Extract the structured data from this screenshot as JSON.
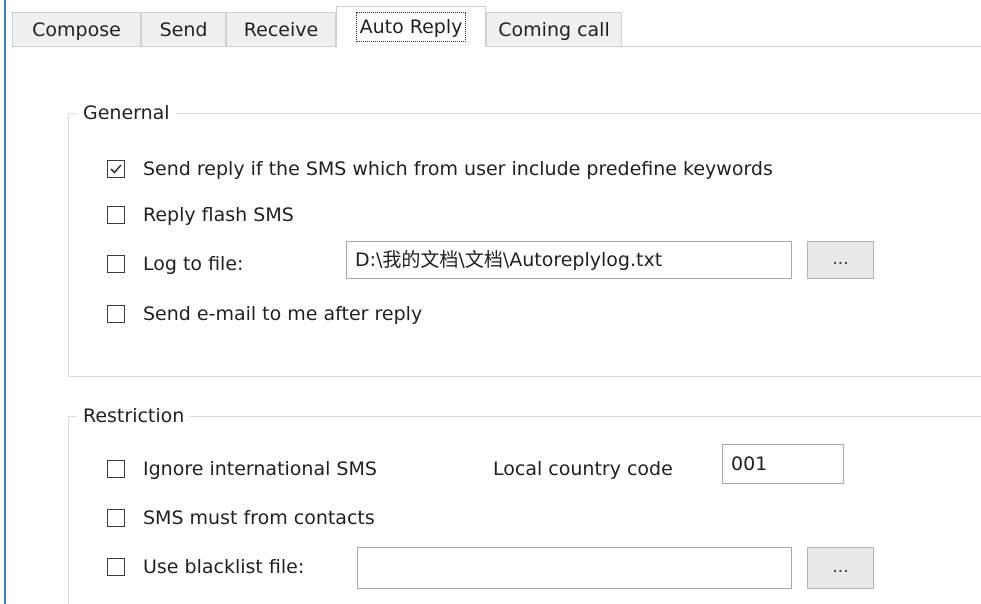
{
  "tabs": [
    {
      "label": "Compose",
      "active": false
    },
    {
      "label": "Send",
      "active": false
    },
    {
      "label": "Receive",
      "active": false
    },
    {
      "label": "Auto Reply",
      "active": true
    },
    {
      "label": "Coming call",
      "active": false
    }
  ],
  "general": {
    "title": "Genernal",
    "send_reply": {
      "label": "Send reply if the SMS which from user include predefine keywords",
      "checked": true
    },
    "reply_flash": {
      "label": "Reply flash SMS",
      "checked": false
    },
    "log_to_file": {
      "label": "Log to file:",
      "checked": false,
      "path": "D:\\我的文档\\文档\\Autoreplylog.txt",
      "browse_label": "..."
    },
    "send_email": {
      "label": "Send e-mail to me after reply",
      "checked": false
    }
  },
  "restriction": {
    "title": "Restriction",
    "ignore_international": {
      "label": "Ignore international SMS",
      "checked": false
    },
    "local_country_code_label": "Local country code",
    "local_country_code": "001",
    "must_from_contacts": {
      "label": "SMS must from contacts",
      "checked": false
    },
    "use_blacklist": {
      "label": "Use blacklist file:",
      "checked": false,
      "path": "",
      "browse_label": "..."
    }
  },
  "colors": {
    "accent": "#3f7cc1",
    "tab_bg": "#f0f0f0",
    "button_bg": "#e9e9e9"
  }
}
